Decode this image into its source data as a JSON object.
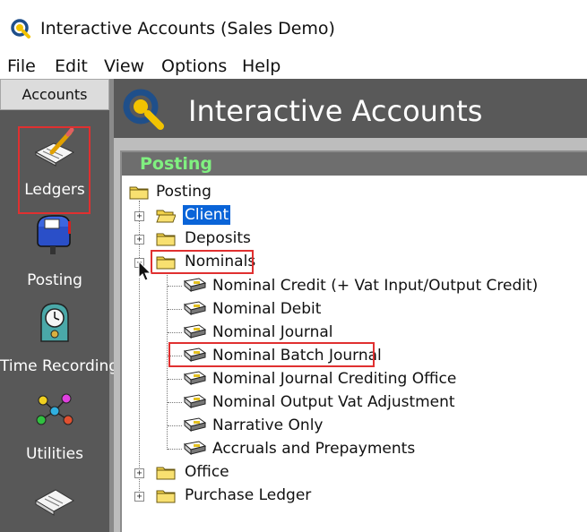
{
  "window": {
    "title": "Interactive Accounts (Sales Demo)"
  },
  "menu": [
    "File",
    "Edit",
    "View",
    "Options",
    "Help"
  ],
  "nav": {
    "header": "Accounts",
    "items": [
      {
        "label": "Ledgers",
        "icon": "ledgers-icon"
      },
      {
        "label": "Posting",
        "icon": "posting-icon",
        "selected": true
      },
      {
        "label": "Time Recording",
        "icon": "time-recording-icon"
      },
      {
        "label": "Utilities",
        "icon": "utilities-icon"
      },
      {
        "label": "",
        "icon": "documents-icon"
      }
    ]
  },
  "banner": {
    "title": "Interactive Accounts"
  },
  "panel": {
    "title": "Posting"
  },
  "tree": {
    "root": "Posting",
    "folders": [
      {
        "label": "Client",
        "selected": true
      },
      {
        "label": "Deposits"
      },
      {
        "label": "Nominals",
        "expanded": true
      },
      {
        "label": "Office"
      },
      {
        "label": "Purchase Ledger"
      }
    ],
    "nominals": [
      "Nominal Credit (+ Vat Input/Output Credit)",
      "Nominal Debit",
      "Nominal Journal",
      "Nominal Batch Journal",
      "Nominal Journal Crediting Office",
      "Nominal Output Vat Adjustment",
      "Narrative Only",
      "Accruals and Prepayments"
    ]
  },
  "colors": {
    "panel_title": "#80f080",
    "highlight": "#e03030",
    "selection": "#0a64d8"
  }
}
